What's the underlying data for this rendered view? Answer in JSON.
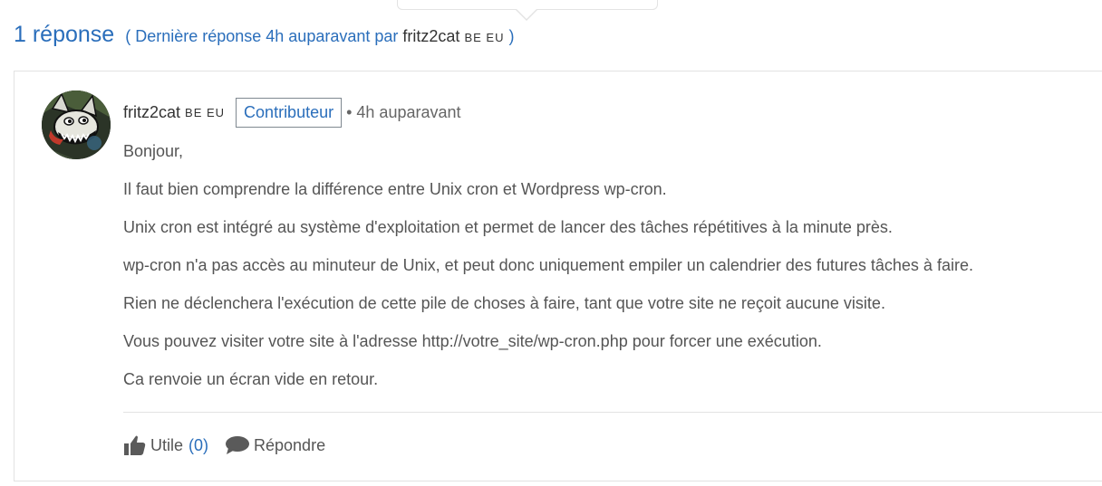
{
  "thread": {
    "reply_count_label": "1 réponse",
    "last_reply_prefix": "( Dernière réponse 4h auparavant par",
    "last_reply_author": "fritz2cat",
    "last_reply_flags": "BE EU",
    "last_reply_suffix": ")"
  },
  "post": {
    "author": "fritz2cat",
    "author_flags": "BE EU",
    "role_badge": "Contributeur",
    "time": "• 4h auparavant",
    "paragraphs": [
      "Bonjour,",
      "Il faut bien comprendre la différence entre Unix cron et Wordpress wp-cron.",
      "Unix cron est intégré au système d'exploitation et permet de lancer des tâches répétitives à la minute près.",
      "wp-cron n'a pas accès au minuteur de Unix, et peut donc uniquement empiler un calendrier des futures tâches à faire.",
      "Rien ne déclenchera l'exécution de cette pile de choses à faire, tant que votre site ne reçoit aucune visite.",
      "Vous pouvez visiter votre site à l'adresse http://votre_site/wp-cron.php pour forcer une exécution.",
      "Ca renvoie un écran vide en retour."
    ],
    "actions": {
      "useful_label": "Utile",
      "useful_count": "(0)",
      "reply_label": "Répondre"
    }
  },
  "icons": {
    "useful": "thumbs-up-icon",
    "reply": "speech-bubble-icon"
  },
  "colors": {
    "link_blue": "#2a6ebb",
    "text_gray": "#555555",
    "border_gray": "#e2e2e2"
  }
}
